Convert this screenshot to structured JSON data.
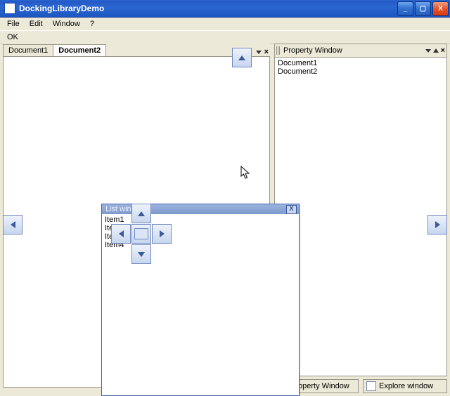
{
  "window": {
    "title": "DockingLibraryDemo"
  },
  "menu": {
    "file": "File",
    "edit": "Edit",
    "window": "Window",
    "help": "?"
  },
  "toolbar": {
    "ok": "OK"
  },
  "docTabs": {
    "t1": "Document1",
    "t2": "Document2"
  },
  "property": {
    "title": "Property Window",
    "items": {
      "i1": "Document1",
      "i2": "Document2"
    }
  },
  "floating": {
    "title": "List window",
    "items": {
      "i1": "Item1",
      "i2": "Item2",
      "i3": "Item3",
      "i4": "Item4"
    }
  },
  "autohide": {
    "b1": "Property Window",
    "b2": "Explore window"
  }
}
